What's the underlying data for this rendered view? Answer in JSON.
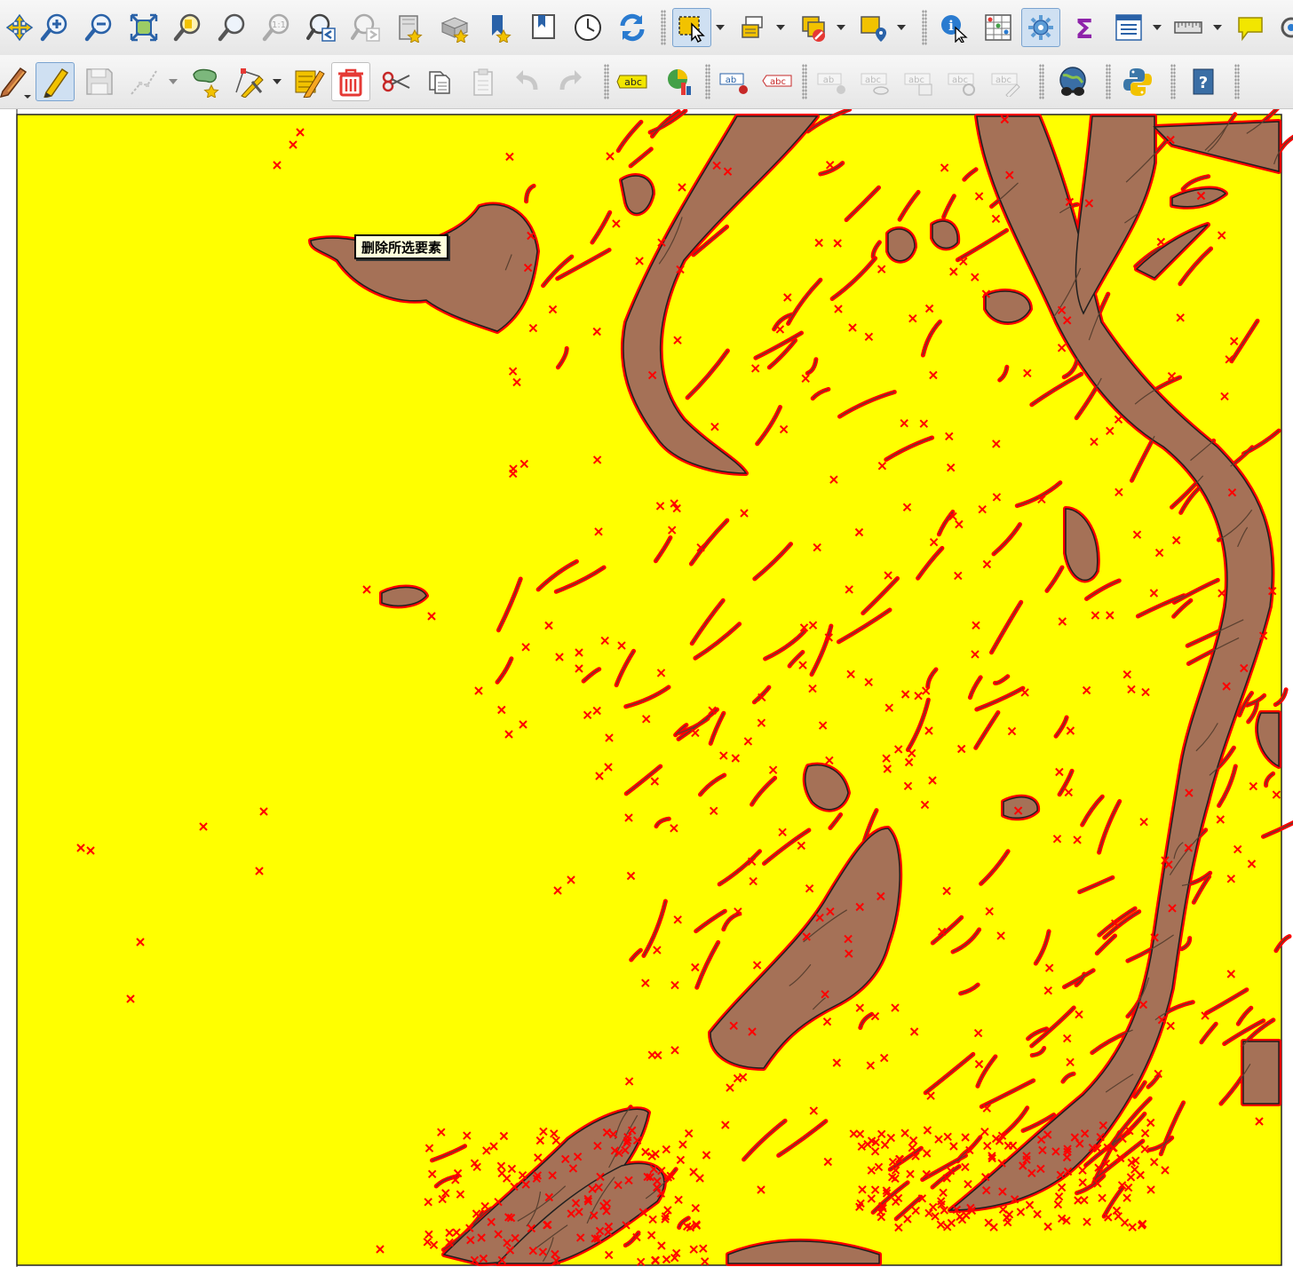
{
  "toolbar_top": {
    "tools": [
      {
        "name": "pan-map-to-selection-icon",
        "glyph": "✥"
      },
      {
        "name": "zoom-in-icon",
        "glyph": "+"
      },
      {
        "name": "zoom-out-icon",
        "glyph": "−"
      },
      {
        "name": "zoom-full-icon",
        "glyph": "⤢"
      },
      {
        "name": "zoom-to-selection-icon",
        "glyph": "◻"
      },
      {
        "name": "zoom-to-layer-icon",
        "glyph": "◻"
      },
      {
        "name": "zoom-native-resolution-icon",
        "glyph": "1:1"
      },
      {
        "name": "zoom-last-icon",
        "glyph": "◂"
      },
      {
        "name": "zoom-next-icon",
        "glyph": "▸"
      },
      {
        "name": "new-map-view-icon",
        "glyph": "▦"
      },
      {
        "name": "new-3d-map-view-icon",
        "glyph": "▤"
      },
      {
        "name": "new-bookmark-icon",
        "glyph": "⚑"
      },
      {
        "name": "show-bookmarks-icon",
        "glyph": "▯"
      },
      {
        "name": "temporal-controller-icon",
        "glyph": "◷"
      },
      {
        "name": "refresh-icon",
        "glyph": "⟳"
      },
      {
        "name": "select-features-icon",
        "glyph": "⬚"
      },
      {
        "name": "select-by-value-icon",
        "glyph": "≣"
      },
      {
        "name": "deselect-features-icon",
        "glyph": "⊘"
      },
      {
        "name": "select-by-location-icon",
        "glyph": "⌖"
      },
      {
        "name": "identify-features-icon",
        "glyph": "i"
      },
      {
        "name": "open-attribute-table-icon",
        "glyph": "▦"
      },
      {
        "name": "toolbox-icon",
        "glyph": "⚙"
      },
      {
        "name": "statistical-summary-icon",
        "glyph": "Σ"
      },
      {
        "name": "field-calculator-icon",
        "glyph": "▤"
      },
      {
        "name": "measure-line-icon",
        "glyph": "▭"
      },
      {
        "name": "map-tips-icon",
        "glyph": "💬"
      },
      {
        "name": "settings-icon",
        "glyph": "⚙"
      }
    ]
  },
  "toolbar_edit": {
    "tools": [
      {
        "name": "current-edits-icon"
      },
      {
        "name": "toggle-editing-icon"
      },
      {
        "name": "save-layer-edits-icon"
      },
      {
        "name": "digitize-line-icon"
      },
      {
        "name": "add-polygon-feature-icon"
      },
      {
        "name": "vertex-tool-icon"
      },
      {
        "name": "modify-attributes-icon"
      },
      {
        "name": "delete-selected-icon"
      },
      {
        "name": "cut-features-icon"
      },
      {
        "name": "copy-features-icon"
      },
      {
        "name": "paste-features-icon"
      },
      {
        "name": "undo-icon"
      },
      {
        "name": "redo-icon"
      },
      {
        "name": "label-toolbar-icon",
        "text": "abc"
      },
      {
        "name": "diagram-icon"
      },
      {
        "name": "pin-label-icon",
        "text": "ab"
      },
      {
        "name": "highlight-label-icon",
        "text": "abc"
      },
      {
        "name": "pin-labels-disabled-icon",
        "text": "ab"
      },
      {
        "name": "show-hide-labels-icon",
        "text": "abc"
      },
      {
        "name": "move-label-icon",
        "text": "abc"
      },
      {
        "name": "rotate-label-icon",
        "text": "abc"
      },
      {
        "name": "change-label-icon",
        "text": "abc"
      },
      {
        "name": "georeferencer-icon"
      },
      {
        "name": "python-console-icon"
      },
      {
        "name": "help-icon",
        "text": "?"
      }
    ]
  },
  "tooltip": {
    "text": "删除所选要素"
  },
  "map": {
    "background": "#ffff00",
    "polygon_fill": "#a57157",
    "polygon_stroke": "#1f1f1f",
    "vertex_color": "#ff0000"
  }
}
